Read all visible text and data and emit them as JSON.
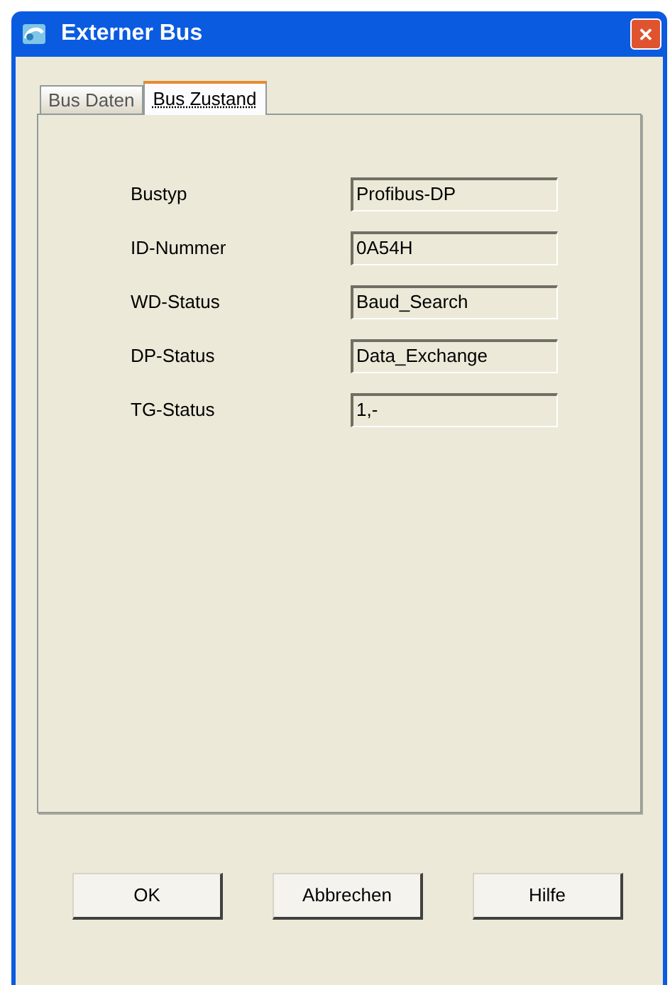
{
  "window": {
    "title": "Externer Bus",
    "close_button": "✕"
  },
  "tabs": [
    {
      "label": "Bus Daten",
      "selected": false
    },
    {
      "label": "Bus Zustand",
      "selected": true
    }
  ],
  "fields": [
    {
      "label": "Bustyp",
      "value": "Profibus-DP"
    },
    {
      "label": "ID-Nummer",
      "value": "0A54H"
    },
    {
      "label": "WD-Status",
      "value": "Baud_Search"
    },
    {
      "label": "DP-Status",
      "value": "Data_Exchange"
    },
    {
      "label": "TG-Status",
      "value": "1,-"
    }
  ],
  "buttons": [
    "OK",
    "Abbrechen",
    "Hilfe"
  ]
}
